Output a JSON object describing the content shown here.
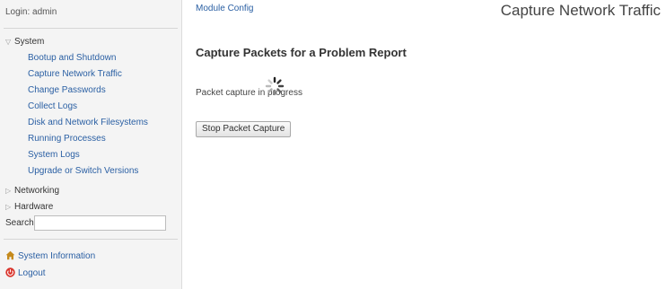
{
  "sidebar": {
    "login_text": "Login: admin",
    "system_label": "System",
    "system_items": [
      "Bootup and Shutdown",
      "Capture Network Traffic",
      "Change Passwords",
      "Collect Logs",
      "Disk and Network Filesystems",
      "Running Processes",
      "System Logs",
      "Upgrade or Switch Versions"
    ],
    "networking_label": "Networking",
    "hardware_label": "Hardware",
    "search_label": "Search:",
    "search_value": "",
    "system_information_label": "System Information",
    "logout_label": "Logout"
  },
  "header": {
    "module_config_label": "Module Config",
    "page_title": "Capture Network Traffic"
  },
  "main": {
    "section_title": "Capture Packets for a Problem Report",
    "progress_text": "Packet capture in progress",
    "stop_button_label": "Stop Packet Capture"
  },
  "icons": {
    "tree_expanded": "triangle-down-icon",
    "tree_collapsed": "triangle-right-icon",
    "system_information": "house-icon",
    "logout": "power-icon",
    "spinner": "loading-spinner-icon"
  },
  "colors": {
    "link": "#2a5fa3",
    "sidebar_bg": "#f4f4f4",
    "logout_icon": "#d9332b",
    "house_icon": "#c58a1c"
  }
}
